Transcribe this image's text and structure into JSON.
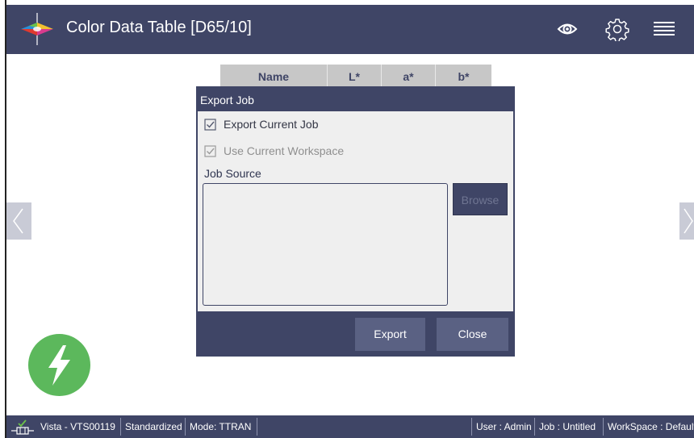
{
  "header": {
    "title": "Color Data Table [D65/10]",
    "icons": [
      "eye-icon",
      "gear-icon",
      "menu-icon"
    ]
  },
  "table": {
    "columns": [
      "Name",
      "L*",
      "a*",
      "b*"
    ]
  },
  "dialog": {
    "title": "Export Job",
    "export_current_job": {
      "label": "Export Current Job",
      "checked": true
    },
    "use_current_workspace": {
      "label": "Use Current Workspace",
      "checked": true,
      "disabled": true
    },
    "job_source_label": "Job Source",
    "job_source_value": "",
    "browse_label": "Browse",
    "export_label": "Export",
    "close_label": "Close"
  },
  "status": {
    "device": "Vista - VTS00119",
    "state": "Standardized",
    "mode": "Mode: TTRAN",
    "user": "User : Admin",
    "job": "Job : Untitled",
    "workspace": "WorkSpace : Default"
  },
  "colors": {
    "primary": "#3f4566",
    "button": "#5a6183",
    "dialog_body": "#efefef",
    "bolt_green": "#5cb85c",
    "table_header": "#c7c7c7"
  }
}
